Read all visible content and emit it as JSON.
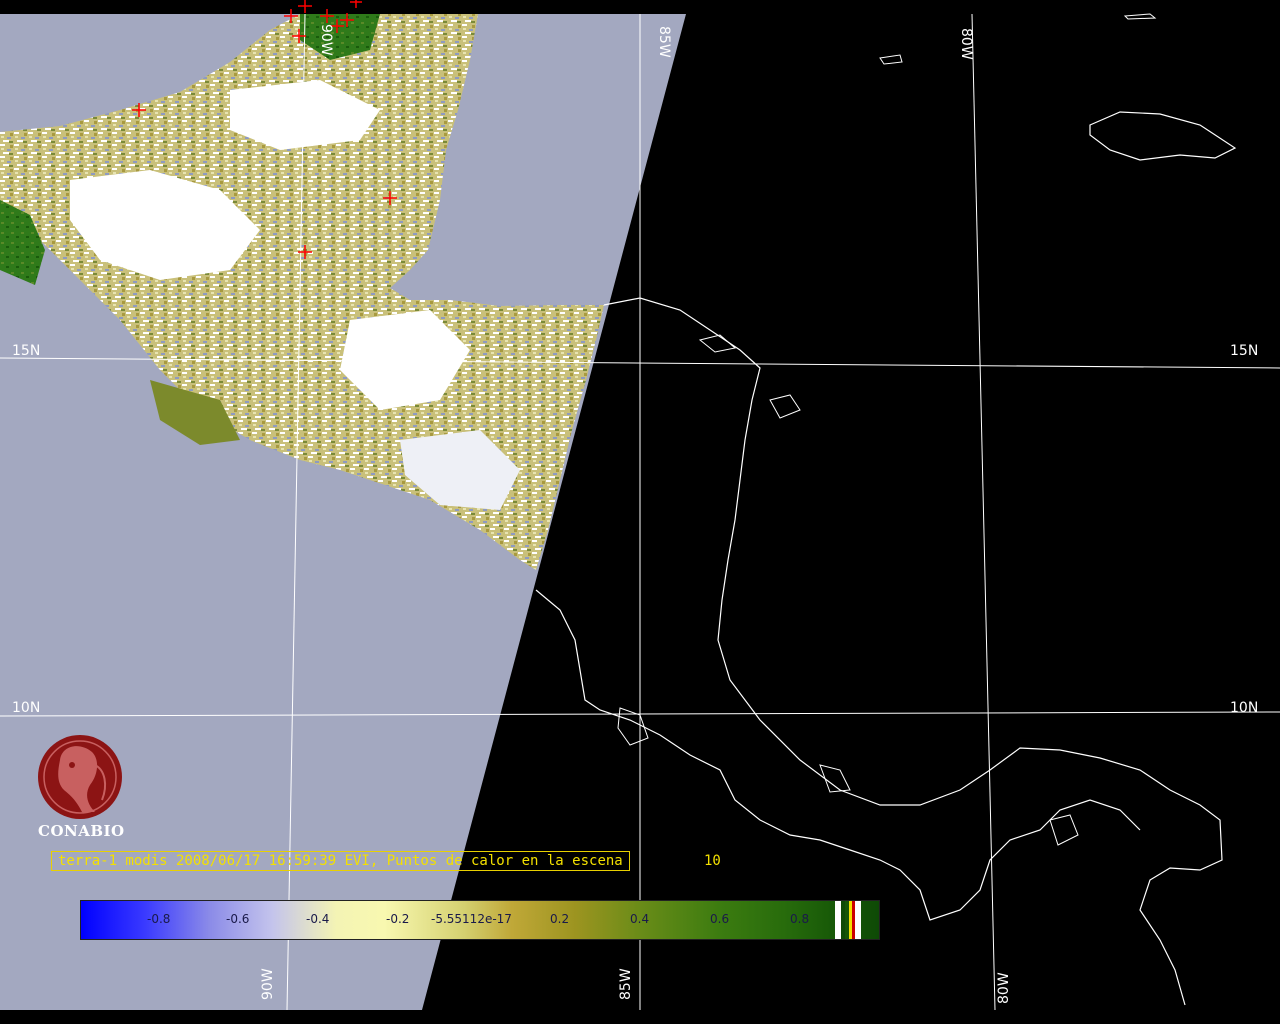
{
  "map": {
    "grid_labels": {
      "lat_15n_left": "15N",
      "lat_15n_right": "15N",
      "lat_10n_left": "10N",
      "lat_10n_right": "10N",
      "lon_85w_top": "85W",
      "lon_80w_top": "80W",
      "lon_90w_top": "90W",
      "lon_90w_bottom": "90W",
      "lon_85w_bottom": "85W",
      "lon_80w_bottom": "80W"
    },
    "colors": {
      "no_data": "#a3a8c0",
      "night": "#000000",
      "grid": "#ffffff",
      "coastline": "#ffffff",
      "hotspot": "#ff0000"
    }
  },
  "logo": {
    "name": "CONABIO",
    "color": "#8c1414"
  },
  "caption": {
    "text": "terra-1 modis 2008/06/17 16:59:39 EVI, Puntos de calor en la escena",
    "count": "10",
    "color": "#f3e000"
  },
  "colorbar": {
    "ticks": [
      "-0.8",
      "-0.6",
      "-0.4",
      "-0.2",
      "-5.55112e-17",
      "0.2",
      "0.4",
      "0.6",
      "0.8"
    ],
    "min_color": "#0000ff",
    "max_color": "#0e4a06"
  }
}
